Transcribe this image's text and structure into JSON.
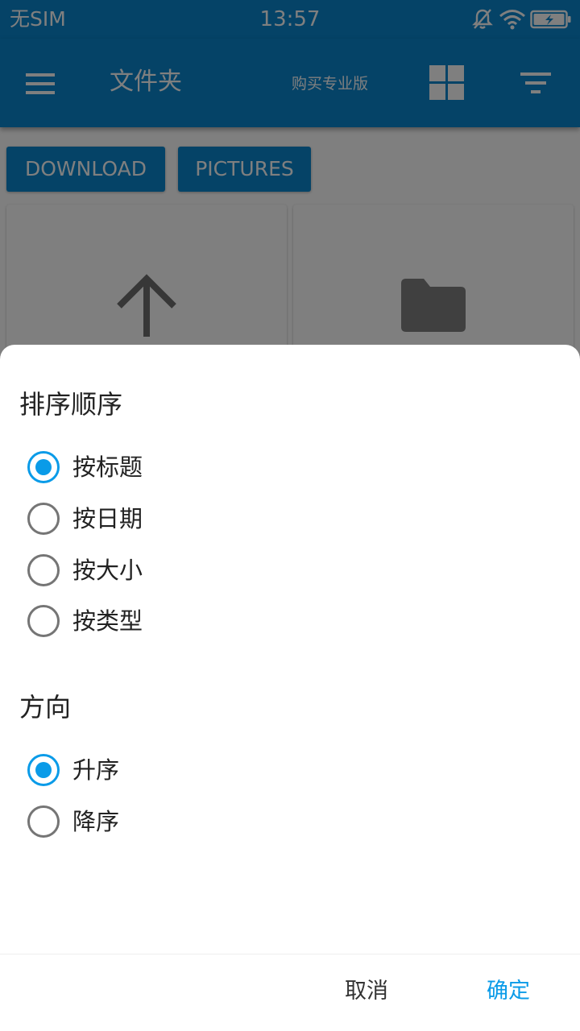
{
  "status_bar": {
    "carrier": "无SIM",
    "time": "13:57",
    "icons": [
      "bell-muted-icon",
      "wifi-icon",
      "battery-charging-icon"
    ]
  },
  "app_bar": {
    "title": "文件夹",
    "buy_pro": "购买专业版",
    "icons": [
      "menu-icon",
      "grid-view-icon",
      "filter-icon"
    ]
  },
  "breadcrumbs": [
    "DOWNLOAD",
    "PICTURES"
  ],
  "tiles": [
    {
      "icon": "arrow-up-icon"
    },
    {
      "icon": "folder-icon"
    }
  ],
  "dialog": {
    "sort_title": "排序顺序",
    "sort_options": [
      {
        "label": "按标题",
        "checked": true
      },
      {
        "label": "按日期",
        "checked": false
      },
      {
        "label": "按大小",
        "checked": false
      },
      {
        "label": "按类型",
        "checked": false
      }
    ],
    "direction_title": "方向",
    "direction_options": [
      {
        "label": "升序",
        "checked": true
      },
      {
        "label": "降序",
        "checked": false
      }
    ],
    "cancel": "取消",
    "confirm": "确定"
  },
  "colors": {
    "primary": "#0a86cf",
    "accent": "#0a9be8",
    "radio_unchecked": "#757575"
  }
}
